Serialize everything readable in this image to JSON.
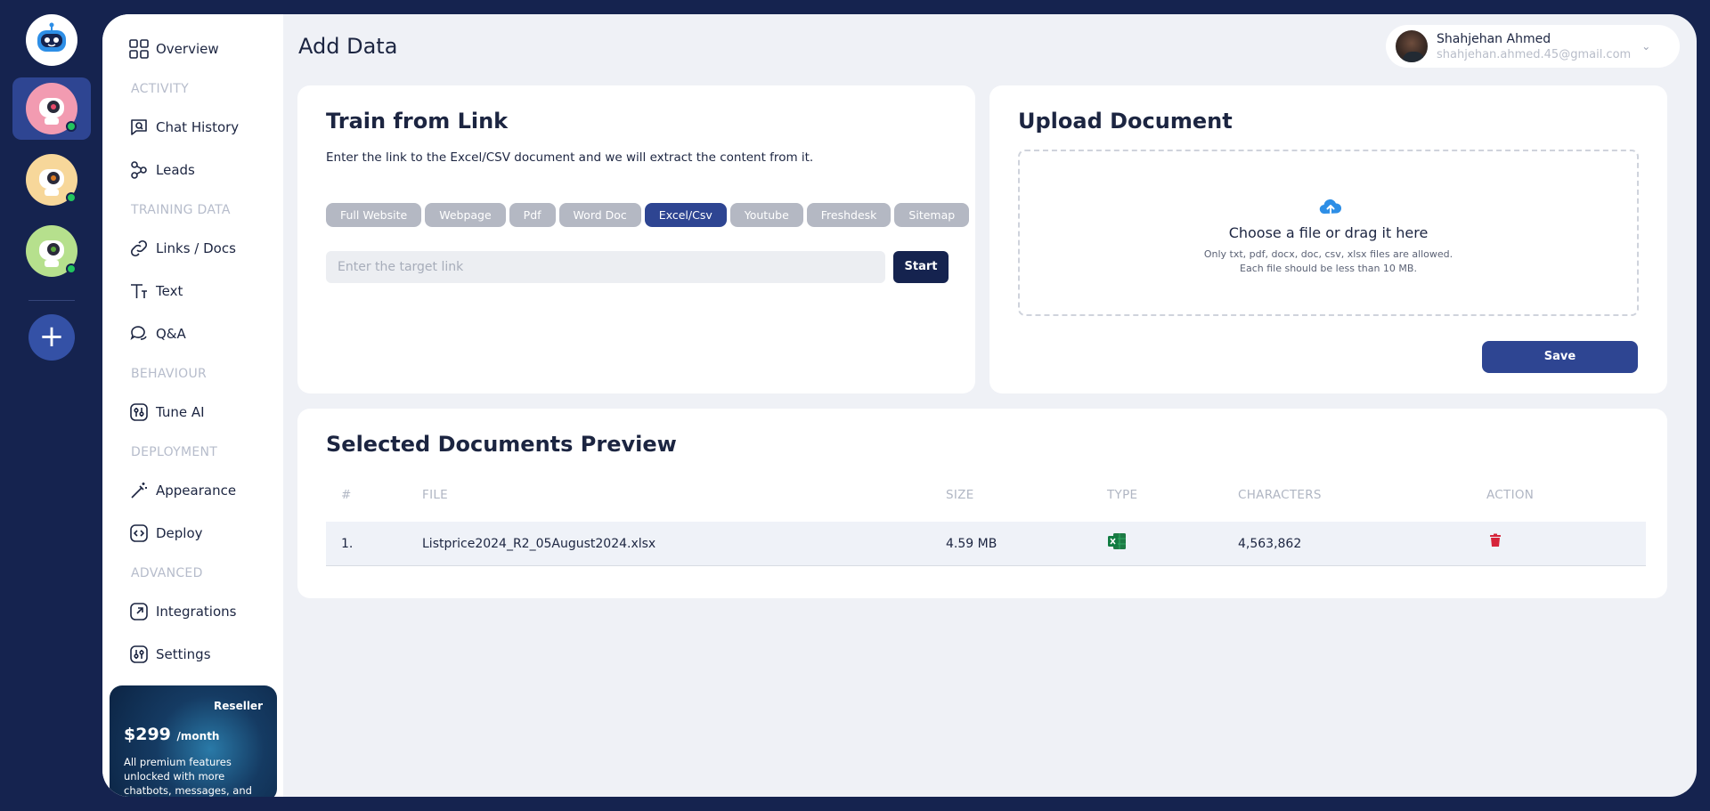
{
  "rail": {
    "bots": [
      {
        "name": "bot-pink",
        "color": "#f29bb1",
        "status": "online"
      },
      {
        "name": "bot-yellow",
        "color": "#f7d79a",
        "status": "online"
      },
      {
        "name": "bot-green",
        "color": "#b6e08d",
        "status": "online"
      }
    ],
    "add_label": "+"
  },
  "sidebar": {
    "overview": "Overview",
    "sections": {
      "activity": "ACTIVITY",
      "training": "TRAINING DATA",
      "behaviour": "BEHAVIOUR",
      "deployment": "DEPLOYMENT",
      "advanced": "ADVANCED"
    },
    "items": {
      "chat_history": "Chat History",
      "leads": "Leads",
      "links_docs": "Links / Docs",
      "text": "Text",
      "qa": "Q&A",
      "tune_ai": "Tune AI",
      "appearance": "Appearance",
      "deploy": "Deploy",
      "integrations": "Integrations",
      "settings": "Settings"
    },
    "promo": {
      "tag": "Reseller",
      "price": "$299",
      "period": "/month",
      "description": "All premium features unlocked with more chatbots, messages, and"
    }
  },
  "header": {
    "title": "Add Data",
    "user": {
      "name": "Shahjehan Ahmed",
      "email": "shahjehan.ahmed.45@gmail.com"
    }
  },
  "train_link": {
    "title": "Train from Link",
    "hint": "Enter the link to the Excel/CSV document and we will extract the content from it.",
    "types": [
      "Full Website",
      "Webpage",
      "Pdf",
      "Word Doc",
      "Excel/Csv",
      "Youtube",
      "Freshdesk",
      "Sitemap"
    ],
    "active_type": "Excel/Csv",
    "input_placeholder": "Enter the target link",
    "input_value": "",
    "start_label": "Start"
  },
  "upload": {
    "title": "Upload Document",
    "drop_title": "Choose a file or drag it here",
    "drop_hint_1": "Only txt, pdf, docx, doc, csv, xlsx files are allowed.",
    "drop_hint_2": "Each file should be less than 10 MB.",
    "save_label": "Save"
  },
  "preview": {
    "title": "Selected Documents Preview",
    "columns": {
      "num": "#",
      "file": "FILE",
      "size": "SIZE",
      "type": "TYPE",
      "characters": "CHARACTERS",
      "action": "ACTION"
    },
    "rows": [
      {
        "num": "1.",
        "file": "Listprice2024_R2_05August2024.xlsx",
        "size": "4.59 MB",
        "type": "excel-icon",
        "characters": "4,563,862"
      }
    ]
  },
  "colors": {
    "navy": "#15234f",
    "accent": "#2e4592",
    "success": "#22c55e",
    "danger": "#d6243a",
    "excel": "#1d7a45",
    "upload_icon": "#2d8ee6"
  }
}
